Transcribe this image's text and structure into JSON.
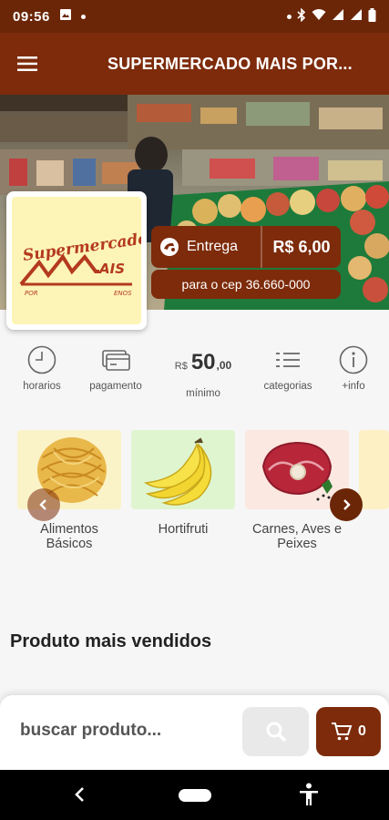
{
  "status_bar": {
    "time": "09:56"
  },
  "app_bar": {
    "title": "SUPERMERCADO MAIS POR..."
  },
  "store": {
    "logo_text": "Supermercado",
    "logo_big": "AIS",
    "logo_sub_left": "POR",
    "logo_sub_right": "ENOS"
  },
  "delivery": {
    "label": "Entrega",
    "price": "R$ 6,00",
    "cep": "para o cep 36.660-000"
  },
  "info": {
    "horarios": "horarios",
    "pagamento": "pagamento",
    "min_currency": "R$",
    "min_int": "50",
    "min_dec": ",00",
    "minimo": "mínimo",
    "categorias": "categorias",
    "mais_info": "+info"
  },
  "categories": [
    {
      "name": "Alimentos Básicos"
    },
    {
      "name": "Hortifruti"
    },
    {
      "name": "Carnes, Aves e Peixes"
    }
  ],
  "section_title": "Produto mais vendidos",
  "search": {
    "placeholder": "buscar produto..."
  },
  "cart": {
    "count": "0"
  },
  "colors": {
    "brand": "#7d2b0b",
    "status_bar": "#6b2607"
  }
}
